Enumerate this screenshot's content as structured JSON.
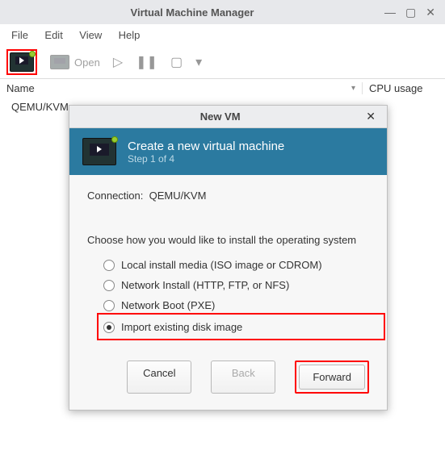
{
  "window": {
    "title": "Virtual Machine Manager"
  },
  "menubar": [
    "File",
    "Edit",
    "View",
    "Help"
  ],
  "toolbar": {
    "open": "Open"
  },
  "columns": {
    "name": "Name",
    "cpu": "CPU usage"
  },
  "connection_row": "QEMU/KVM",
  "dialog": {
    "title": "New VM",
    "header": {
      "title": "Create a new virtual machine",
      "step": "Step 1 of 4"
    },
    "connection_label": "Connection:",
    "connection_value": "QEMU/KVM",
    "choose": "Choose how you would like to install the operating system",
    "options": {
      "local": "Local install media (ISO image or CDROM)",
      "net": "Network Install (HTTP, FTP, or NFS)",
      "pxe": "Network Boot (PXE)",
      "import": "Import existing disk image"
    },
    "buttons": {
      "cancel": "Cancel",
      "back": "Back",
      "forward": "Forward"
    }
  }
}
